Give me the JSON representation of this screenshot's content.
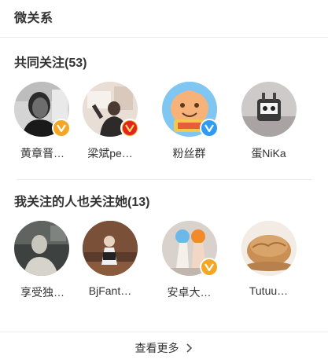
{
  "header": {
    "title": "微关系"
  },
  "colors": {
    "badge_orange": "#f5a623",
    "badge_blue": "#2f9bf2"
  },
  "common_follows": {
    "title": "共同关注(53)",
    "users": [
      {
        "name": "黄章晋…",
        "avatar_icon": "portrait-bw-icon",
        "badge": "orange-v-badge"
      },
      {
        "name": "梁斌pe…",
        "avatar_icon": "person-in-room-icon",
        "badge": "red-v-badge"
      },
      {
        "name": "粉丝群",
        "avatar_icon": "cartoon-face-icon",
        "badge": "blue-v-badge"
      },
      {
        "name": "蛋NiKa",
        "avatar_icon": "robot-toy-icon",
        "badge": ""
      }
    ]
  },
  "following_also_follow": {
    "title": "我关注的人也关注她(13)",
    "users": [
      {
        "name": "享受独…",
        "avatar_icon": "dark-portrait-icon",
        "badge": ""
      },
      {
        "name": "BjFant…",
        "avatar_icon": "figure-on-stage-icon",
        "badge": ""
      },
      {
        "name": "安卓大…",
        "avatar_icon": "anime-figures-icon",
        "badge": "orange-v-badge"
      },
      {
        "name": "Tutuu…",
        "avatar_icon": "bread-icon",
        "badge": ""
      }
    ]
  },
  "footer": {
    "more_label": "查看更多"
  }
}
